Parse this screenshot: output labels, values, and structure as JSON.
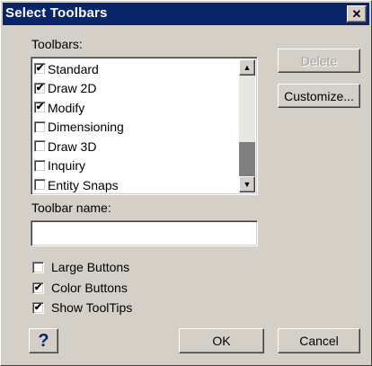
{
  "dialog": {
    "title": "Select Toolbars",
    "close_glyph": "✕"
  },
  "toolbars_label": "Toolbars:",
  "toolbars": [
    {
      "label": "Standard",
      "checked": true
    },
    {
      "label": "Draw 2D",
      "checked": true
    },
    {
      "label": "Modify",
      "checked": true
    },
    {
      "label": "Dimensioning",
      "checked": false
    },
    {
      "label": "Draw 3D",
      "checked": false
    },
    {
      "label": "Inquiry",
      "checked": false
    },
    {
      "label": "Entity Snaps",
      "checked": false
    }
  ],
  "check_glyph": "✔",
  "scroll": {
    "up_glyph": "▲",
    "down_glyph": "▼"
  },
  "toolbar_name_label": "Toolbar name:",
  "toolbar_name_value": "",
  "buttons": {
    "delete": "Delete",
    "customize": "Customize...",
    "help": "?",
    "ok": "OK",
    "cancel": "Cancel"
  },
  "options": [
    {
      "label": "Large Buttons",
      "checked": false
    },
    {
      "label": "Color Buttons",
      "checked": true
    },
    {
      "label": "Show ToolTips",
      "checked": true
    }
  ],
  "colors": {
    "titlebar": "#0a246a",
    "face": "#d4d0c8"
  }
}
